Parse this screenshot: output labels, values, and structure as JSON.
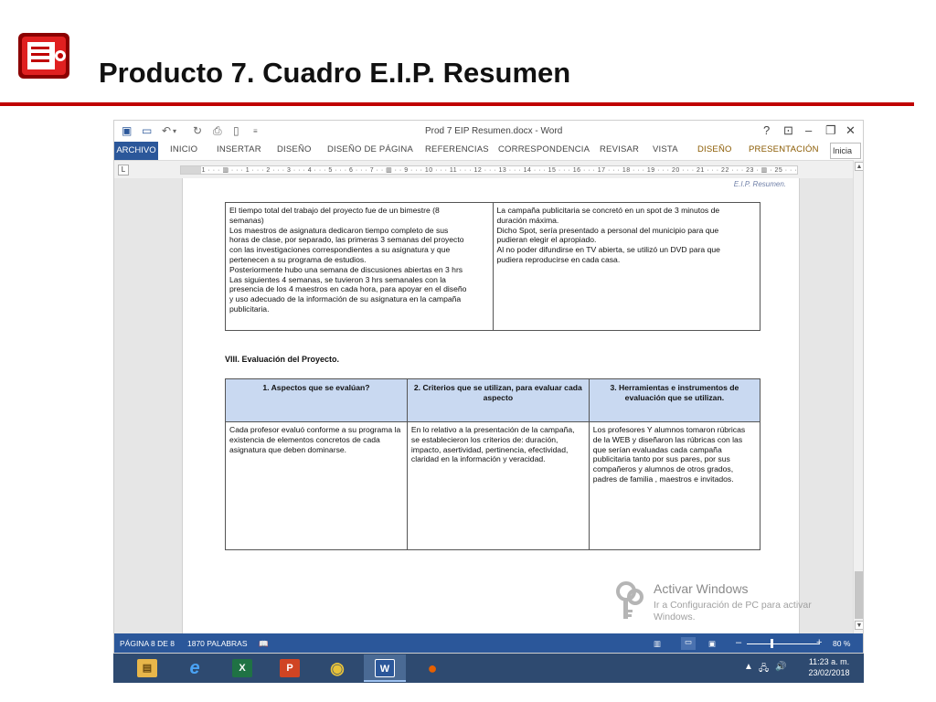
{
  "slide": {
    "title": "Producto 7. Cuadro E.I.P. Resumen",
    "logo": "presentation-logo-icon",
    "accent_color": "#c00000"
  },
  "word": {
    "doc_title": "Prod 7 EIP Resumen.docx - Word",
    "window_controls": [
      "?",
      "⊡",
      "–",
      "❐",
      "✕"
    ],
    "ribbon_tabs": [
      "ARCHIVO",
      "INICIO",
      "INSERTAR",
      "DISEÑO",
      "DISEÑO DE PÁGINA",
      "REFERENCIAS",
      "CORRESPONDENCIA",
      "REVISAR",
      "VISTA",
      "DISEÑO",
      "PRESENTACIÓN",
      "Inicia"
    ],
    "ruler_text": "2 · · · 1 · · · ▥ · · · 1 · · · 2 · · · 3 · · · 4 · · · 5 · · · 6 · · · 7 · · ▥ · · 9 · · · 10 · · · 11 · · · 12 · · · 13 · · · 14 · · · 15 · · · 16 · · · 17 · · · 18 · · · 19 · · · 20 · · · 21 · · · 22 · · · 23 · ▥ · 25 · · ·",
    "header_note": "E.I.P. Resumen.",
    "table1": {
      "left_lines": [
        "El tiempo total del trabajo del proyecto fue de un bimestre (8",
        "semanas)",
        "Los maestros de asignatura dedicaron tiempo completo de sus",
        "horas de clase, por separado, las primeras 3 semanas del proyecto",
        "con las investigaciones correspondientes a su asignatura y que",
        "pertenecen a su programa de estudios.",
        "Posteriormente hubo una semana de discusiones abiertas en 3 hrs",
        "Las siguientes 4 semanas, se tuvieron 3 hrs semanales con la",
        "presencia de los 4 maestros en cada hora, para apoyar en el diseño",
        "y uso adecuado de la información de su asignatura en la campaña",
        "publicitaria."
      ],
      "right_lines": [
        "La campaña publicitaria se concretó en un spot de 3 minutos de",
        "duración máxima.",
        "Dicho Spot, sería presentado a personal del municipio para que",
        "pudieran elegir el apropiado.",
        "Al no poder difundirse en TV abierta, se utilizó un DVD para que",
        "pudiera reproducirse en cada casa."
      ]
    },
    "section_heading": "VIII. Evaluación del Proyecto.",
    "table2": {
      "headers": [
        "1. Aspectos  que se evalúan?",
        "2. Criterios que se utilizan, para evaluar cada aspecto",
        "3. Herramientas e instrumentos de evaluación que se utilizan."
      ],
      "cells": [
        "Cada profesor evaluó conforme a su programa la existencia de elementos concretos de cada asignatura que deben dominarse.",
        "En lo relativo a la presentación de la campaña, se establecieron los criterios de: duración,  impacto, asertividad, pertinencia, efectividad, claridad en la información y veracidad.",
        "Los profesores Y alumnos tomaron rúbricas de la WEB y diseñaron las rúbricas con las que serían evaluadas cada campaña publicitaria tanto por sus pares, por sus compañeros y alumnos de otros grados, padres de familia , maestros e invitados."
      ]
    },
    "watermark": {
      "title": "Activar Windows",
      "subtitle": "Ir a Configuración de PC para activar Windows."
    },
    "status_bar": {
      "page": "PÁGINA 8 DE 8",
      "words": "1870 PALABRAS",
      "zoom": "80 %",
      "zoom_minus": "–",
      "zoom_plus": "+"
    },
    "brand_color": "#2b579a"
  },
  "taskbar": {
    "apps": [
      {
        "name": "file-explorer-icon",
        "glyph": "▤",
        "color": "#e8b64a"
      },
      {
        "name": "internet-explorer-icon",
        "glyph": "e",
        "color": "#1e88e5"
      },
      {
        "name": "excel-icon",
        "glyph": "X",
        "color": "#1f7244"
      },
      {
        "name": "powerpoint-icon",
        "glyph": "P",
        "color": "#d04423"
      },
      {
        "name": "chrome-icon",
        "glyph": "◉",
        "color": "#dd4b39"
      },
      {
        "name": "word-icon",
        "glyph": "W",
        "color": "#2b579a"
      },
      {
        "name": "firefox-icon",
        "glyph": "●",
        "color": "#e66000"
      }
    ],
    "time": "11:23 a. m.",
    "date": "23/02/2018"
  }
}
